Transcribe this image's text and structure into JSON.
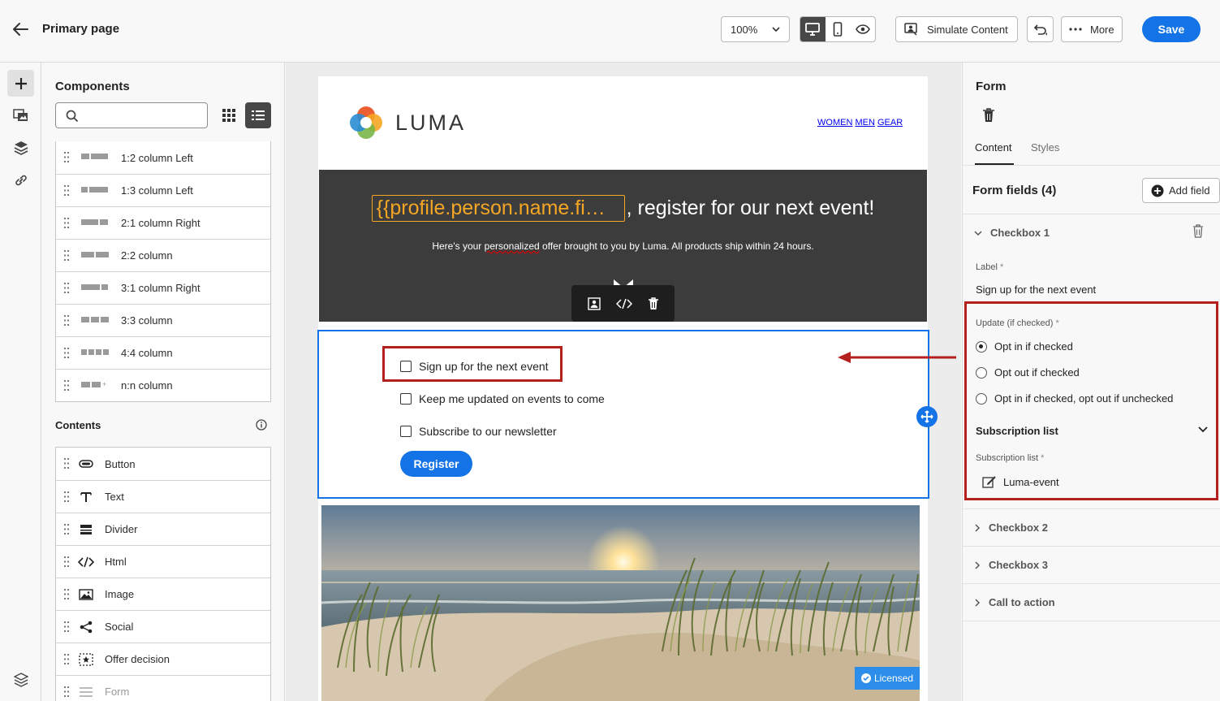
{
  "header": {
    "title": "Primary page",
    "zoom": "100%",
    "simulate_label": "Simulate Content",
    "more_label": "More",
    "save_label": "Save"
  },
  "components": {
    "title": "Components",
    "search_placeholder": "",
    "layouts": [
      {
        "label": "1:2 column Left",
        "cols": [
          1,
          2
        ]
      },
      {
        "label": "1:3 column Left",
        "cols": [
          1,
          3
        ]
      },
      {
        "label": "2:1 column Right",
        "cols": [
          2,
          1
        ]
      },
      {
        "label": "2:2 column",
        "cols": [
          2,
          2
        ]
      },
      {
        "label": "3:1 column Right",
        "cols": [
          3,
          1
        ]
      },
      {
        "label": "3:3 column",
        "cols": [
          1,
          1,
          1
        ]
      },
      {
        "label": "4:4 column",
        "cols": [
          1,
          1,
          1,
          1
        ]
      },
      {
        "label": "n:n column",
        "cols": [
          1,
          1,
          "+"
        ]
      }
    ],
    "contents_title": "Contents",
    "contents": [
      {
        "label": "Button",
        "icon": "button-icon"
      },
      {
        "label": "Text",
        "icon": "text-icon"
      },
      {
        "label": "Divider",
        "icon": "divider-icon"
      },
      {
        "label": "Html",
        "icon": "code-icon"
      },
      {
        "label": "Image",
        "icon": "image-icon"
      },
      {
        "label": "Social",
        "icon": "share-icon"
      },
      {
        "label": "Offer decision",
        "icon": "offer-icon"
      },
      {
        "label": "Form",
        "icon": "form-icon"
      }
    ]
  },
  "email": {
    "logo_text": "LUMA",
    "nav": [
      "WOMEN",
      "MEN",
      "GEAR"
    ],
    "personalization_token": "{{profile.person.name.fi…",
    "hero_title": ", register for our next event!",
    "hero_sub_before": "Here's your ",
    "hero_sub_word": "personalized",
    "hero_sub_after": " offer brought to you by Luma. All products ship within 24 hours.",
    "form_fields": [
      "Sign up for the next event",
      "Keep me updated on events to come",
      "Subscribe to our newsletter"
    ],
    "register_label": "Register",
    "licensed_label": "Licensed"
  },
  "props": {
    "title": "Form",
    "tabs": [
      "Content",
      "Styles"
    ],
    "form_fields_title": "Form fields (4)",
    "add_field_label": "Add field",
    "checkbox1": {
      "title": "Checkbox 1",
      "label_caption": "Label",
      "label_value": "Sign up for the next event",
      "update_caption": "Update (if checked)",
      "options": [
        "Opt in if checked",
        "Opt out if checked",
        "Opt in if checked, opt out if unchecked"
      ],
      "selected_option": 0,
      "subscription_header": "Subscription list",
      "subscription_caption": "Subscription list",
      "subscription_value": "Luma-event"
    },
    "collapsed": [
      "Checkbox 2",
      "Checkbox 3",
      "Call to action"
    ]
  },
  "colors": {
    "accent": "#1473e6",
    "highlight": "#b3201d",
    "token": "#f5a623"
  }
}
